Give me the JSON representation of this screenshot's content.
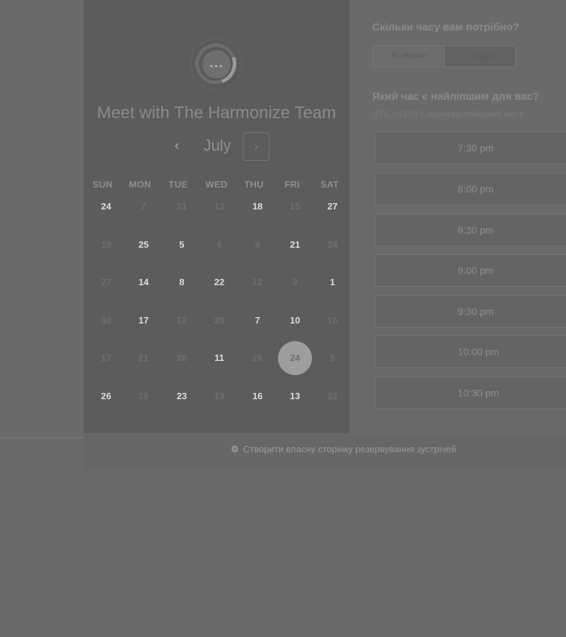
{
  "header": {
    "title": "Meet with The Harmonize Team",
    "month": "July",
    "prev_icon": "‹",
    "next_icon": "›"
  },
  "weekdays": [
    "SUN",
    "MON",
    "TUE",
    "WED",
    "THU",
    "FRI",
    "SAT"
  ],
  "calendar": {
    "rows": [
      [
        {
          "d": "24",
          "m": false
        },
        {
          "d": "7",
          "m": true
        },
        {
          "d": "21",
          "m": true
        },
        {
          "d": "13",
          "m": true
        },
        {
          "d": "18",
          "m": false
        },
        {
          "d": "15",
          "m": true
        },
        {
          "d": "27",
          "m": false
        }
      ],
      [
        {
          "d": "19",
          "m": true
        },
        {
          "d": "25",
          "m": false
        },
        {
          "d": "5",
          "m": false
        },
        {
          "d": "6",
          "m": true
        },
        {
          "d": "9",
          "m": true
        },
        {
          "d": "21",
          "m": false
        },
        {
          "d": "24",
          "m": true
        }
      ],
      [
        {
          "d": "27",
          "m": true
        },
        {
          "d": "14",
          "m": false
        },
        {
          "d": "8",
          "m": false
        },
        {
          "d": "22",
          "m": false
        },
        {
          "d": "12",
          "m": true
        },
        {
          "d": "3",
          "m": true
        },
        {
          "d": "1",
          "m": false
        }
      ],
      [
        {
          "d": "30",
          "m": true
        },
        {
          "d": "17",
          "m": false
        },
        {
          "d": "12",
          "m": true
        },
        {
          "d": "20",
          "m": true
        },
        {
          "d": "7",
          "m": false
        },
        {
          "d": "10",
          "m": false
        },
        {
          "d": "16",
          "m": true
        }
      ],
      [
        {
          "d": "17",
          "m": true
        },
        {
          "d": "21",
          "m": true
        },
        {
          "d": "28",
          "m": true
        },
        {
          "d": "11",
          "m": false
        },
        {
          "d": "26",
          "m": true
        },
        {
          "d": "24",
          "m": false,
          "selected": true
        },
        {
          "d": "5",
          "m": true
        }
      ],
      [
        {
          "d": "26",
          "m": false
        },
        {
          "d": "15",
          "m": true
        },
        {
          "d": "23",
          "m": false
        },
        {
          "d": "19",
          "m": true
        },
        {
          "d": "16",
          "m": false
        },
        {
          "d": "13",
          "m": false
        },
        {
          "d": "22",
          "m": true
        }
      ]
    ]
  },
  "duration": {
    "question": "Скільки часу вам потрібно?",
    "options": [
      {
        "label": "30 хвилин",
        "active": true
      },
      {
        "label": "1 годин",
        "active": false
      }
    ]
  },
  "time": {
    "question": "Який час є найліпшим для вас?",
    "timezone": "UTC +03:00 Східноєвропейський час ▾",
    "slots": [
      "7:30 pm",
      "8:00 pm",
      "8:30 pm",
      "9:00 pm",
      "9:30 pm",
      "10:00 pm",
      "10:30 pm"
    ]
  },
  "footer": {
    "icon": "⚙",
    "link_text": "Створити власну сторінку резервування зустрічей"
  },
  "colors": {
    "background": "#6a6a6a",
    "left_panel": "#5c5c5c",
    "selected_day": "#9e9e9e"
  }
}
